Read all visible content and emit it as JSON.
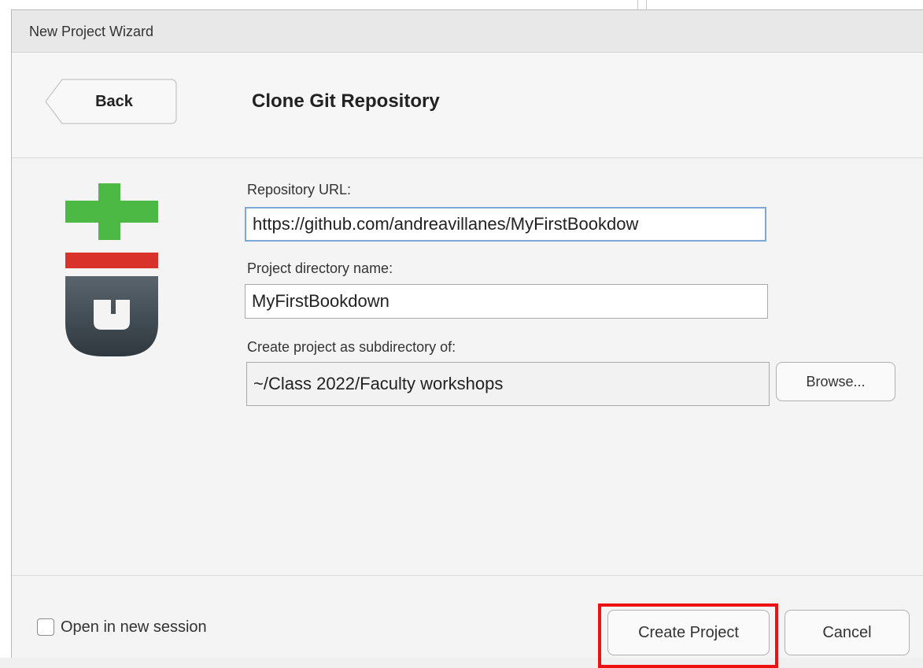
{
  "window": {
    "title": "New Project Wizard"
  },
  "header": {
    "back_label": "Back",
    "heading": "Clone Git Repository"
  },
  "logo": {
    "icon": "git-logo-icon",
    "colors": {
      "plus": "#4cb944",
      "minus": "#d9322b",
      "letter": "#404a52"
    }
  },
  "form": {
    "repo_url": {
      "label": "Repository URL:",
      "value": "https://github.com/andreavillanes/MyFirstBookdow"
    },
    "project_dir": {
      "label": "Project directory name:",
      "value": "MyFirstBookdown"
    },
    "subdir": {
      "label": "Create project as subdirectory of:",
      "value": "~/Class 2022/Faculty workshops"
    },
    "browse_label": "Browse..."
  },
  "footer": {
    "open_new_session_label": "Open in new session",
    "open_new_session_checked": false,
    "create_label": "Create Project",
    "cancel_label": "Cancel",
    "highlight_color": "#ee1111"
  }
}
